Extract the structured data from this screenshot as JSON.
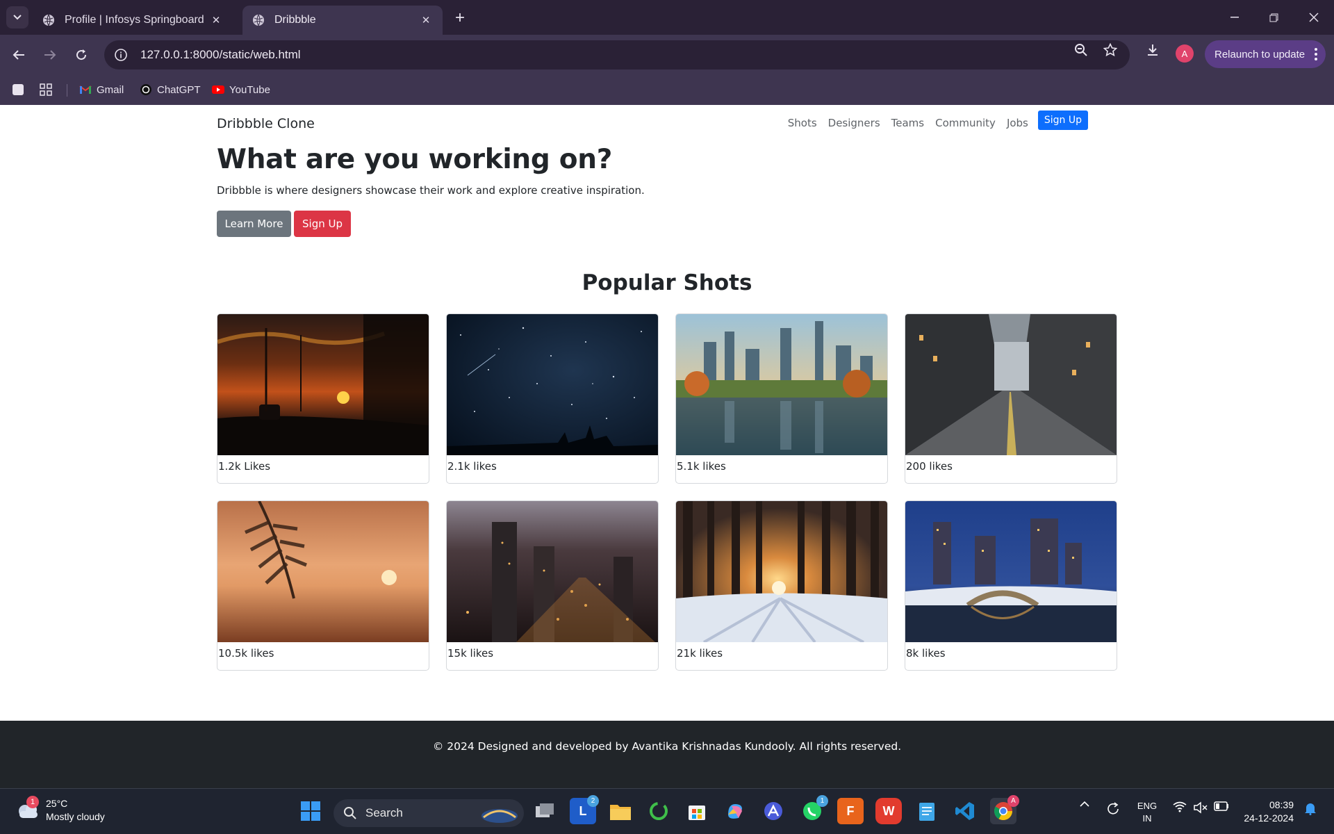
{
  "browser": {
    "tabs": [
      {
        "title": "Profile | Infosys Springboard",
        "active": false
      },
      {
        "title": "Dribbble",
        "active": true
      }
    ],
    "url": "127.0.0.1:8000/static/web.html",
    "relaunch_label": "Relaunch to update",
    "profile_initial": "A",
    "bookmarks": [
      "Gmail",
      "ChatGPT",
      "YouTube"
    ]
  },
  "page": {
    "brand": "Dribbble Clone",
    "nav": [
      "Shots",
      "Designers",
      "Teams",
      "Community",
      "Jobs"
    ],
    "nav_signup": "Sign Up",
    "hero_title": "What are you working on?",
    "hero_subtitle": "Dribbble is where designers showcase their work and explore creative inspiration.",
    "learn_more": "Learn More",
    "signup": "Sign Up",
    "section_title": "Popular Shots",
    "shots": [
      {
        "likes": "1.2k Likes",
        "image": "sunset-road"
      },
      {
        "likes": "2.1k likes",
        "image": "starry-night"
      },
      {
        "likes": "5.1k likes",
        "image": "city-lake-reflection"
      },
      {
        "likes": "200 likes",
        "image": "city-street"
      },
      {
        "likes": "10.5k likes",
        "image": "palm-sunset"
      },
      {
        "likes": "15k likes",
        "image": "city-night-lights"
      },
      {
        "likes": "21k likes",
        "image": "snowy-forest-sunrise"
      },
      {
        "likes": "8k likes",
        "image": "winter-park-bridge"
      }
    ],
    "footer": "© 2024 Designed and developed by Avantika Krishnadas Kundooly. All rights reserved."
  },
  "taskbar": {
    "weather_temp": "25°C",
    "weather_desc": "Mostly cloudy",
    "weather_badge": "1",
    "search_label": "Search",
    "lang_top": "ENG",
    "lang_bottom": "IN",
    "time": "08:39",
    "date": "24-12-2024",
    "apps": [
      "windows-start",
      "task-view",
      "l-app",
      "file-explorer",
      "refresh-app",
      "microsoft-store",
      "copilot",
      "a-app",
      "whatsapp",
      "f-app",
      "wps-office",
      "notepad",
      "vscode",
      "chrome"
    ]
  }
}
